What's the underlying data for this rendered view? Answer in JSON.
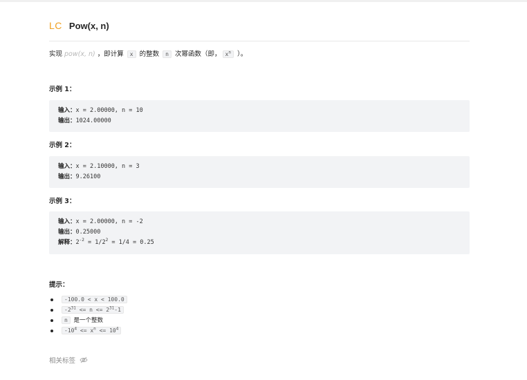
{
  "problem": {
    "logo": "LC",
    "title": "Pow(x, n)"
  },
  "description": {
    "part1": "实现 ",
    "link_text": "pow(x, n)",
    "part2": " ，即计算 ",
    "code_x": "x",
    "part3": " 的整数 ",
    "code_n": "n",
    "part4": " 次幂函数（即，",
    "code_xn_base": "x",
    "code_xn_sup": "n",
    "part5": " ）。"
  },
  "examples": [
    {
      "title": "示例 1：",
      "input_label": "输入：",
      "input": "x = 2.00000, n = 10",
      "output_label": "输出：",
      "output": "1024.00000"
    },
    {
      "title": "示例 2：",
      "input_label": "输入：",
      "input": "x = 2.10000, n = 3",
      "output_label": "输出：",
      "output": "9.26100"
    },
    {
      "title": "示例 3：",
      "input_label": "输入：",
      "input": "x = 2.00000, n = -2",
      "output_label": "输出：",
      "output": "0.25000",
      "explain_label": "解释：",
      "explain_a": "2",
      "explain_a_sup": "-2",
      "explain_b": " = 1/2",
      "explain_b_sup": "2",
      "explain_c": " = 1/4 = 0.25"
    }
  ],
  "hints": {
    "title": "提示：",
    "h1": "-100.0 < x < 100.0",
    "h2_a": "-2",
    "h2_a_sup": "31",
    "h2_b": " <= n <= 2",
    "h2_b_sup": "31",
    "h2_c": "-1",
    "h3_code": "n",
    "h3_text": " 是一个整数",
    "h4_a": "-10",
    "h4_a_sup": "4",
    "h4_b": " <= x",
    "h4_b_sup": "n",
    "h4_c": " <= 10",
    "h4_c_sup": "4"
  },
  "tags": {
    "label": "相关标签",
    "icon": "eye-slash-icon"
  }
}
